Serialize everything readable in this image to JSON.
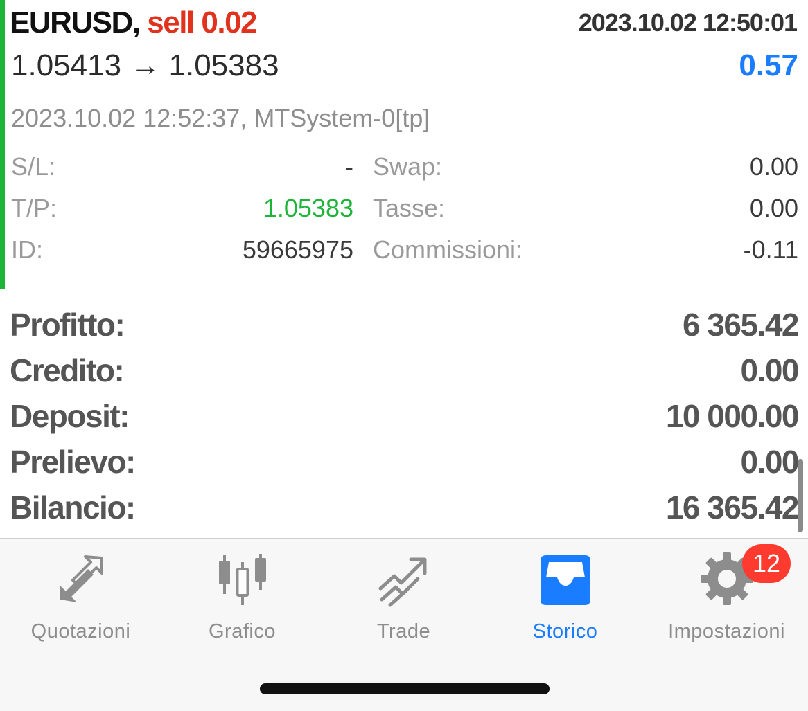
{
  "colors": {
    "accent_green": "#1db43a",
    "sell_red": "#e0321c",
    "profit_blue": "#1a7cff",
    "tab_active_blue": "#1a7cff",
    "badge_red": "#ff3b30"
  },
  "trade": {
    "symbol": "EURUSD,",
    "side": "sell 0.02",
    "open_time": "2023.10.02 12:50:01",
    "price_change": "1.05413 → 1.05383",
    "profit": "0.57",
    "close_info": "2023.10.02 12:52:37, MTSystem-0[tp]",
    "details_left": [
      {
        "label": "S/L:",
        "value": "-"
      },
      {
        "label": "T/P:",
        "value": "1.05383"
      },
      {
        "label": "ID:",
        "value": "59665975"
      }
    ],
    "details_right": [
      {
        "label": "Swap:",
        "value": "0.00"
      },
      {
        "label": "Tasse:",
        "value": "0.00"
      },
      {
        "label": "Commissioni:",
        "value": "-0.11"
      }
    ]
  },
  "summary": [
    {
      "label": "Profitto:",
      "value": "6 365.42"
    },
    {
      "label": "Credito:",
      "value": "0.00"
    },
    {
      "label": "Deposit:",
      "value": "10 000.00"
    },
    {
      "label": "Prelievo:",
      "value": "0.00"
    },
    {
      "label": "Bilancio:",
      "value": "16 365.42"
    }
  ],
  "tabs": [
    {
      "label": "Quotazioni",
      "icon": "quotes-arrows-icon",
      "active": false
    },
    {
      "label": "Grafico",
      "icon": "candlestick-chart-icon",
      "active": false
    },
    {
      "label": "Trade",
      "icon": "trade-trend-icon",
      "active": false
    },
    {
      "label": "Storico",
      "icon": "history-inbox-icon",
      "active": true
    },
    {
      "label": "Impostazioni",
      "icon": "gear-icon",
      "active": false
    }
  ],
  "settings_badge": "12"
}
